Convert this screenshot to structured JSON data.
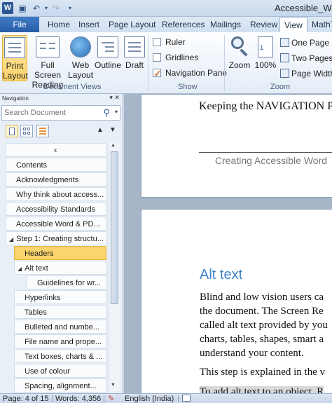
{
  "titlebar": {
    "title": "Accessible_Wo",
    "app_icon": "W",
    "qat": [
      "save-icon",
      "undo-icon",
      "redo-icon",
      "customize-icon"
    ]
  },
  "tabs": {
    "file": "File",
    "items": [
      "Home",
      "Insert",
      "Page Layout",
      "References",
      "Mailings",
      "Review",
      "View",
      "MathT"
    ],
    "active": "View"
  },
  "ribbon": {
    "document_views": {
      "label": "Document Views",
      "buttons": [
        {
          "label1": "Print",
          "label2": "Layout"
        },
        {
          "label1": "Full Screen",
          "label2": "Reading"
        },
        {
          "label1": "Web",
          "label2": "Layout"
        },
        {
          "label1": "Outline",
          "label2": ""
        },
        {
          "label1": "Draft",
          "label2": ""
        }
      ]
    },
    "show": {
      "label": "Show",
      "ruler": "Ruler",
      "gridlines": "Gridlines",
      "navigation_pane": "Navigation Pane",
      "ruler_checked": false,
      "gridlines_checked": false,
      "navigation_pane_checked": true
    },
    "zoom": {
      "label": "Zoom",
      "zoom_button": "Zoom",
      "hundred_button": "100%",
      "one_page": "One Page",
      "two_pages": "Two Pages",
      "page_width": "Page Width"
    }
  },
  "nav": {
    "title": "Navigation",
    "search_placeholder": "Search Document",
    "first_item": "x",
    "items": [
      {
        "label": "Contents",
        "level": 0,
        "expander": ""
      },
      {
        "label": "Acknowledgments",
        "level": 0,
        "expander": ""
      },
      {
        "label": "Why think about access...",
        "level": 0,
        "expander": ""
      },
      {
        "label": "Accessibility Standards",
        "level": 0,
        "expander": ""
      },
      {
        "label": "Accessible Word & PDF ...",
        "level": 0,
        "expander": ""
      },
      {
        "label": "Step 1: Creating structu...",
        "level": 0,
        "expander": "◢"
      },
      {
        "label": "Headers",
        "level": 1,
        "expander": "",
        "selected": true
      },
      {
        "label": "Alt text",
        "level": 1,
        "expander": "◢"
      },
      {
        "label": "Guidelines for wr...",
        "level": 2,
        "expander": ""
      },
      {
        "label": "Hyperlinks",
        "level": 1,
        "expander": ""
      },
      {
        "label": "Tables",
        "level": 1,
        "expander": ""
      },
      {
        "label": "Bulleted and numbe...",
        "level": 1,
        "expander": ""
      },
      {
        "label": "File name and prope...",
        "level": 1,
        "expander": ""
      },
      {
        "label": "Text boxes, charts & ...",
        "level": 1,
        "expander": ""
      },
      {
        "label": "Use of colour",
        "level": 1,
        "expander": ""
      },
      {
        "label": "Spacing, alignment...",
        "level": 1,
        "expander": ""
      }
    ]
  },
  "document": {
    "page1_line": "Keeping the NAVIGATION P",
    "page1_footer": "Creating Accessible Word",
    "heading": "Alt text",
    "para_lines": [
      "Blind and low vision users ca",
      "the document. The Screen Re",
      "called alt text provided by you",
      "charts, tables, shapes, smart a",
      "understand your content."
    ],
    "step_line": "This step is explained in the v",
    "shaded_line": "To add alt text to an object, R"
  },
  "status": {
    "page": "Page: 4 of 15",
    "words": "Words: 4,356",
    "language": "English (India)"
  }
}
